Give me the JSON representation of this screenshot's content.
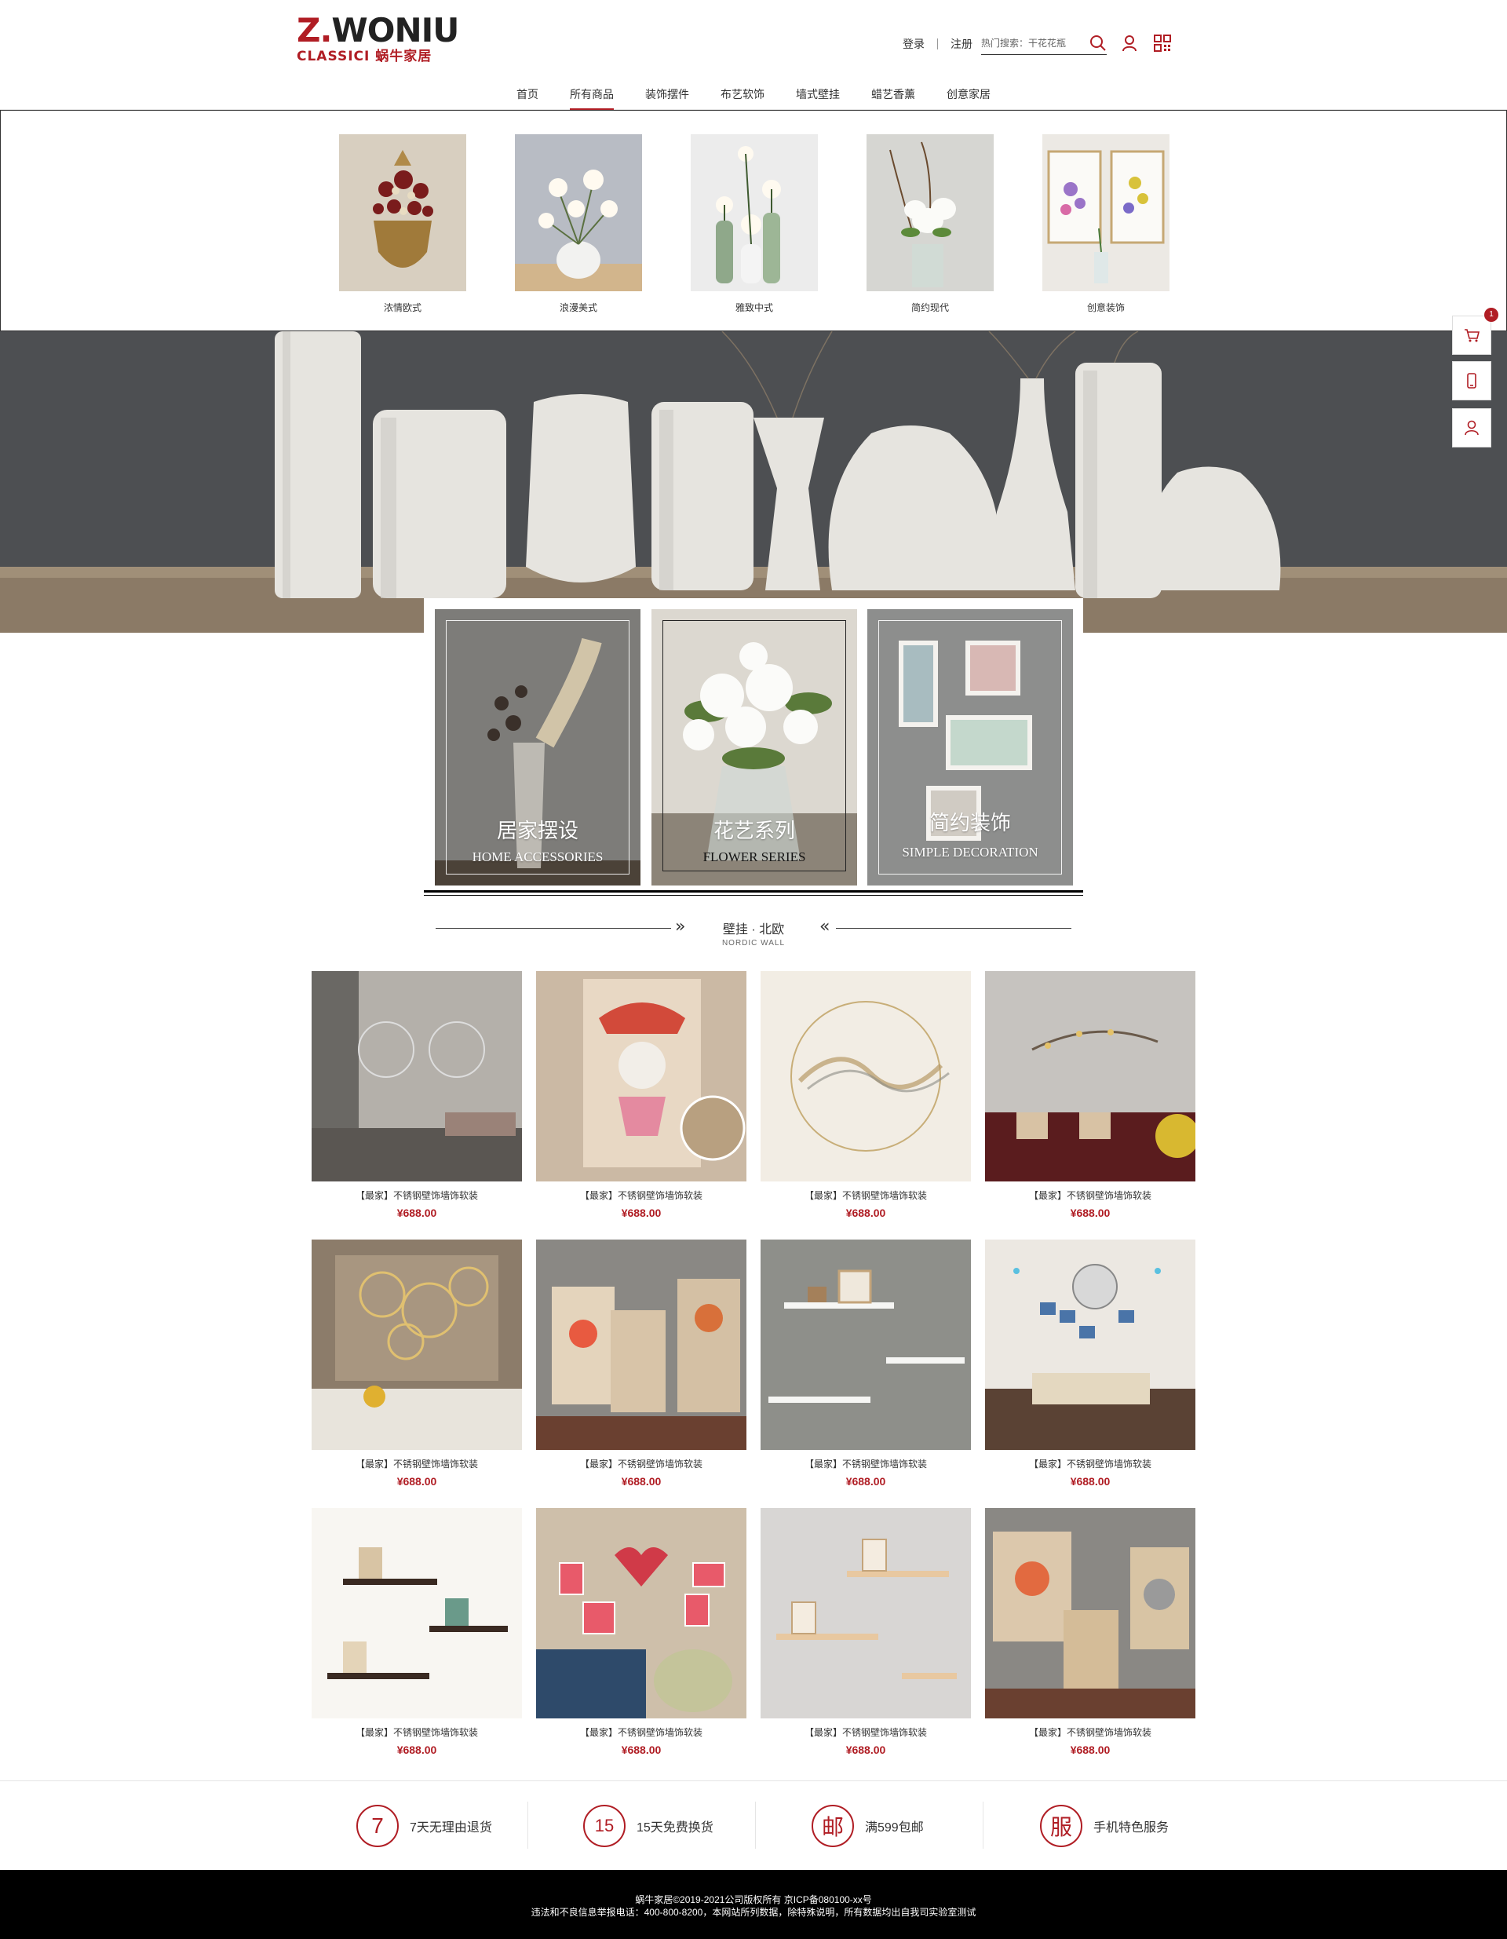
{
  "brand": {
    "logo_main_a": "Z.",
    "logo_main_b": "WONIU",
    "logo_sub": "CLASSICI 蜗牛家居"
  },
  "header": {
    "login": "登录",
    "register": "注册",
    "search_placeholder": "热门搜索：干花花瓶"
  },
  "nav": [
    {
      "label": "首页"
    },
    {
      "label": "所有商品",
      "active": true
    },
    {
      "label": "装饰摆件"
    },
    {
      "label": "布艺软饰"
    },
    {
      "label": "墙式壁挂"
    },
    {
      "label": "蜡艺香薰"
    },
    {
      "label": "创意家居"
    }
  ],
  "categories": [
    {
      "label": "浓情欧式"
    },
    {
      "label": "浪漫美式"
    },
    {
      "label": "雅致中式"
    },
    {
      "label": "简约现代"
    },
    {
      "label": "创意装饰"
    }
  ],
  "features": [
    {
      "title_cn": "居家摆设",
      "title_en": "HOME ACCESSORIES"
    },
    {
      "title_cn": "花艺系列",
      "title_en": "FLOWER SERIES"
    },
    {
      "title_cn": "简约装饰",
      "title_en": "SIMPLE DECORATION"
    }
  ],
  "section": {
    "title_cn": "壁挂 · 北欧",
    "title_en": "NORDIC WALL"
  },
  "products": [
    {
      "name": "【最家】不锈钢壁饰墙饰软装",
      "price": "¥688.00"
    },
    {
      "name": "【最家】不锈钢壁饰墙饰软装",
      "price": "¥688.00"
    },
    {
      "name": "【最家】不锈钢壁饰墙饰软装",
      "price": "¥688.00"
    },
    {
      "name": "【最家】不锈钢壁饰墙饰软装",
      "price": "¥688.00"
    },
    {
      "name": "【最家】不锈钢壁饰墙饰软装",
      "price": "¥688.00"
    },
    {
      "name": "【最家】不锈钢壁饰墙饰软装",
      "price": "¥688.00"
    },
    {
      "name": "【最家】不锈钢壁饰墙饰软装",
      "price": "¥688.00"
    },
    {
      "name": "【最家】不锈钢壁饰墙饰软装",
      "price": "¥688.00"
    },
    {
      "name": "【最家】不锈钢壁饰墙饰软装",
      "price": "¥688.00"
    },
    {
      "name": "【最家】不锈钢壁饰墙饰软装",
      "price": "¥688.00"
    },
    {
      "name": "【最家】不锈钢壁饰墙饰软装",
      "price": "¥688.00"
    },
    {
      "name": "【最家】不锈钢壁饰墙饰软装",
      "price": "¥688.00"
    }
  ],
  "services": [
    {
      "icon_text": "7",
      "text": "7天无理由退货"
    },
    {
      "icon_text": "15",
      "text": "15天免费换货"
    },
    {
      "icon_text": "邮",
      "text": "满599包邮"
    },
    {
      "icon_text": "服",
      "text": "手机特色服务"
    }
  ],
  "footer": {
    "line1": "蜗牛家居©2019-2021公司版权所有 京ICP备080100-xx号",
    "line2": "违法和不良信息举报电话：400-800-8200，本网站所列数据，除特殊说明，所有数据均出自我司实验室测试"
  },
  "sidebar": {
    "cart_count": "1"
  },
  "colors": {
    "accent": "#b01d24",
    "footer_bg": "#000000"
  }
}
